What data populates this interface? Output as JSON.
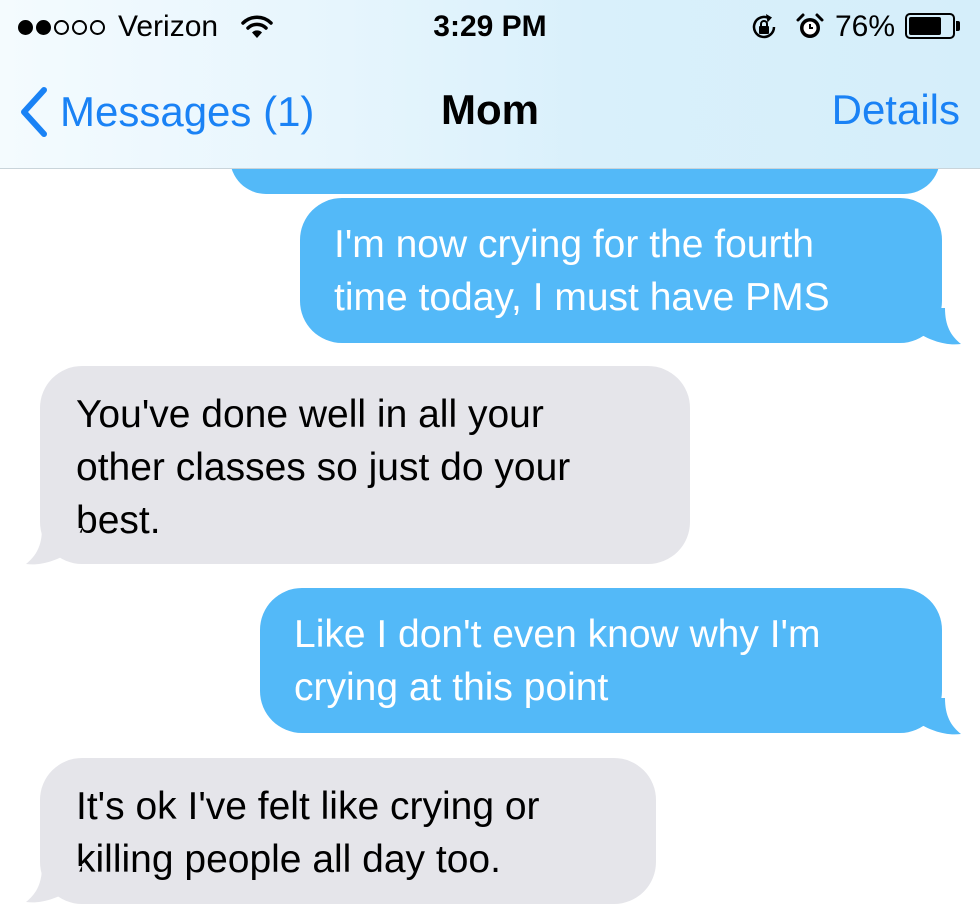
{
  "status_bar": {
    "carrier": "Verizon",
    "signal_bars_filled": 2,
    "signal_bars_total": 5,
    "time": "3:29 PM",
    "battery_percent": "76%",
    "battery_level": 0.76,
    "icons": [
      "wifi-icon",
      "rotation-lock-icon",
      "alarm-clock-icon",
      "battery-icon"
    ]
  },
  "nav": {
    "back_label": "Messages (1)",
    "title": "Mom",
    "details_label": "Details"
  },
  "colors": {
    "accent": "#1a82f5",
    "sent_bubble": "#53b9f8",
    "received_bubble": "#e5e5ea"
  },
  "messages": [
    {
      "sender": "me",
      "text": "I'm now crying for the fourth\ntime today, I must have PMS"
    },
    {
      "sender": "them",
      "text": "You've done well in all your\nother classes so just do your\nbest."
    },
    {
      "sender": "me",
      "text": "Like I don't even know why I'm\ncrying at this point"
    },
    {
      "sender": "them",
      "text": "It's ok I've felt like crying or\nkilling people all day too."
    }
  ]
}
